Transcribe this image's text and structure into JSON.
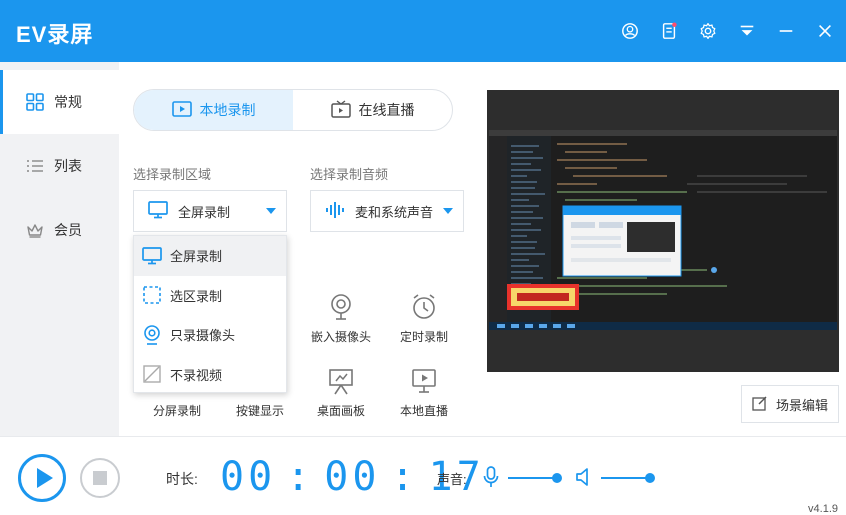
{
  "app": {
    "title": "EV录屏",
    "version": "v4.1.9"
  },
  "colors": {
    "accent": "#1b96ee",
    "sidebar_bg": "#f1f2f4"
  },
  "titlebar_icons": [
    "user-icon",
    "clipboard-icon",
    "gear-icon",
    "menu-icon",
    "minimize-icon",
    "close-icon"
  ],
  "sidebar": {
    "items": [
      {
        "label": "常规",
        "icon": "grid-icon",
        "active": true
      },
      {
        "label": "列表",
        "icon": "list-icon",
        "active": false
      },
      {
        "label": "会员",
        "icon": "crown-icon",
        "active": false
      }
    ]
  },
  "tabs": [
    {
      "label": "本地录制",
      "icon": "record-icon",
      "active": true
    },
    {
      "label": "在线直播",
      "icon": "tv-icon",
      "active": false
    }
  ],
  "area": {
    "label": "选择录制区域",
    "selected": "全屏录制",
    "options": [
      "全屏录制",
      "选区录制",
      "只录摄像头",
      "不录视频"
    ]
  },
  "audio": {
    "label": "选择录制音频",
    "selected": "麦和系统声音"
  },
  "tools": [
    {
      "label": "嵌入摄像头",
      "icon": "webcam-icon"
    },
    {
      "label": "定时录制",
      "icon": "alarm-clock-icon"
    },
    {
      "label": "分屏录制",
      "icon": "split-screen-icon"
    },
    {
      "label": "按键显示",
      "icon": "keyboard-icon"
    },
    {
      "label": "桌面画板",
      "icon": "easel-icon"
    },
    {
      "label": "本地直播",
      "icon": "monitor-play-icon"
    }
  ],
  "scene_button": {
    "label": "场景编辑"
  },
  "bottom": {
    "duration_label": "时长:",
    "timer": {
      "h": "00",
      "m": "00",
      "s": "17"
    },
    "volume_label": "声音:",
    "mic_level": 0.85,
    "speaker_level": 0.85
  }
}
